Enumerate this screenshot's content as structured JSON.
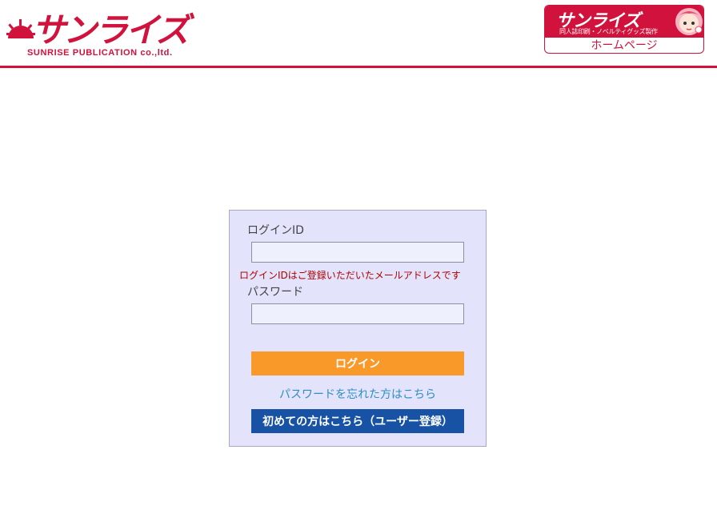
{
  "header": {
    "logo_text": "サンライズ",
    "logo_subtitle": "SUNRISE PUBLICATION co.,ltd.",
    "home_banner": {
      "brand": "サンライズ",
      "tagline": "同人誌印刷・ノベルティグッズ製作",
      "label": "ホームページ"
    }
  },
  "login": {
    "id_label": "ログインID",
    "id_value": "",
    "id_hint": "ログインIDはご登録いただいたメールアドレスです",
    "password_label": "パスワード",
    "password_value": "",
    "submit_label": "ログイン",
    "forgot_label": "パスワードを忘れた方はこちら",
    "register_label": "初めての方はこちら（ユーザー登録）"
  },
  "colors": {
    "brand_red": "#d0123c",
    "panel_bg": "#e3e3fb",
    "login_orange": "#f8992a",
    "register_blue": "#1752a4",
    "link_blue": "#2e8fc0",
    "hint_red": "#b00000"
  }
}
